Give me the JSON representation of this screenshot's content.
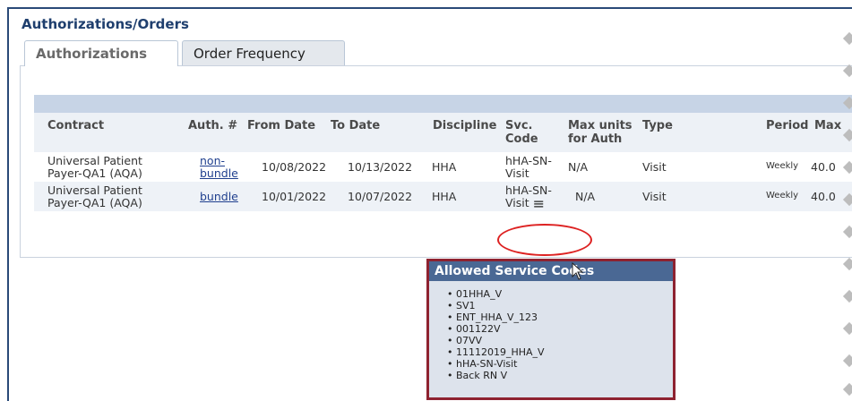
{
  "panel": {
    "title": "Authorizations/Orders"
  },
  "tabs": [
    {
      "label": "Authorizations",
      "active": true
    },
    {
      "label": "Order Frequency",
      "active": false
    }
  ],
  "table": {
    "headers": {
      "contract": "Contract",
      "auth": "Auth. #",
      "from_date": "From Date",
      "to_date": "To Date",
      "discipline": "Discipline",
      "svc_code_1": "Svc.",
      "svc_code_2": "Code",
      "max_units_1": "Max units",
      "max_units_2": "for Auth",
      "type": "Type",
      "period": "Period",
      "max": "Max"
    },
    "rows": [
      {
        "contract_1": "Universal Patient",
        "contract_2": "Payer-QA1 (AQA)",
        "auth_1": "non-",
        "auth_2": "bundle",
        "from_date": "10/08/2022",
        "to_date": "10/13/2022",
        "discipline": "HHA",
        "svc_1": "hHA-SN-",
        "svc_2": "Visit",
        "max_units": "N/A",
        "type": "Visit",
        "period": "Weekly",
        "max": "40.0"
      },
      {
        "contract_1": "Universal Patient",
        "contract_2": "Payer-QA1 (AQA)",
        "auth": "bundle",
        "from_date": "10/01/2022",
        "to_date": "10/07/2022",
        "discipline": "HHA",
        "svc_1": "hHA-SN-",
        "svc_2": "Visit",
        "max_units": "N/A",
        "type": "Visit",
        "period": "Weekly",
        "max": "40.0"
      }
    ]
  },
  "popup": {
    "title": "Allowed Service Codes",
    "codes": [
      "01HHA_V",
      "SV1",
      "ENT_HHA_V_123",
      "001122V",
      "07VV",
      "11112019_HHA_V",
      "hHA-SN-Visit",
      "Back RN V"
    ]
  },
  "icons": {
    "service_codes": "stack-icon",
    "cursor": "pointer-cursor-icon"
  },
  "colors": {
    "title": "#1f3f6e",
    "popup_border": "#8e2230",
    "popup_header": "#4a6894",
    "highlight": "#d22222"
  }
}
